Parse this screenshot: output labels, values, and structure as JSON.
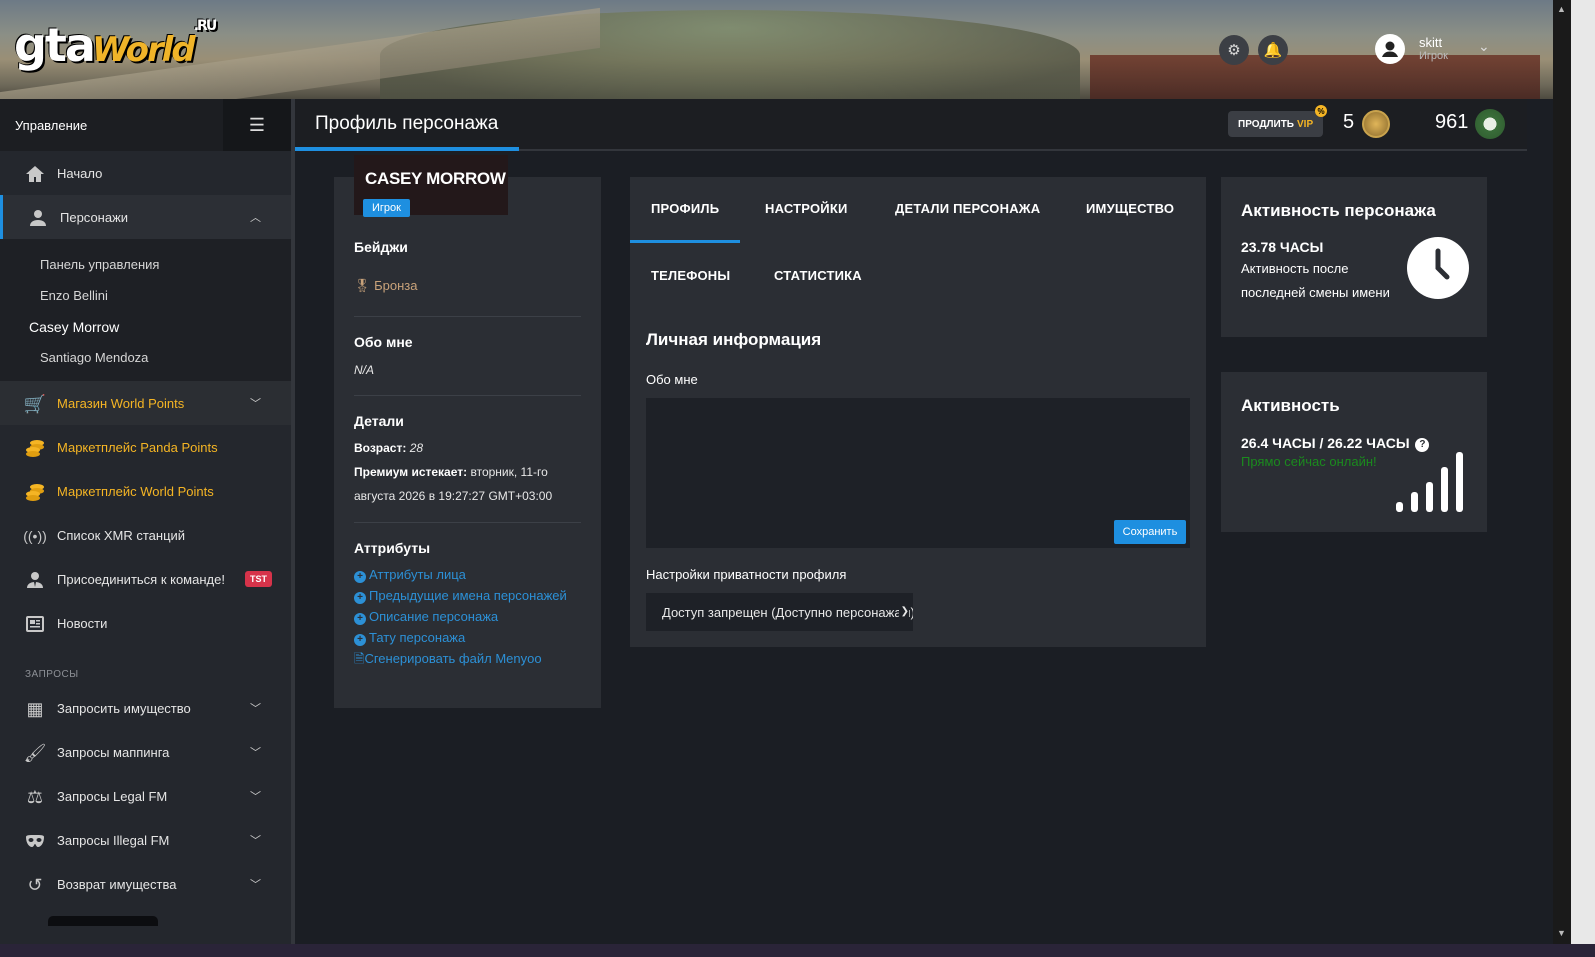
{
  "header": {
    "logo_text": "gta",
    "logo_world": "World",
    "logo_ru": ".RU",
    "user_name": "skitt",
    "user_role": "Игрок",
    "icons": [
      "gear-icon",
      "bell-icon",
      "user-avatar-icon",
      "chevron-down-icon"
    ]
  },
  "sidebar": {
    "title": "Управление",
    "items": [
      {
        "label": "Начало",
        "icon": "home-icon"
      },
      {
        "label": "Персонажи",
        "icon": "person-icon"
      }
    ],
    "characters": [
      "Панель управления",
      "Enzo Bellini",
      "Casey Morrow",
      "Santiago Mendoza"
    ],
    "shop_items": [
      {
        "label": "Магазин World Points",
        "icon": "cart-icon"
      },
      {
        "label": "Маркетплейс Panda Points",
        "icon": "coins-icon"
      },
      {
        "label": "Маркетплейс World Points",
        "icon": "coins-icon"
      }
    ],
    "misc_items": [
      {
        "label": "Список XMR станций",
        "icon": "antenna-icon"
      },
      {
        "label": "Присоединиться к команде!",
        "icon": "user-tie-icon",
        "badge": "TST"
      },
      {
        "label": "Новости",
        "icon": "newspaper-icon"
      }
    ],
    "requests_label": "ЗАПРОСЫ",
    "request_items": [
      {
        "label": "Запросить имущество",
        "icon": "building-icon"
      },
      {
        "label": "Запросы маппинга",
        "icon": "brush-icon"
      },
      {
        "label": "Запросы Legal FM",
        "icon": "scales-icon"
      },
      {
        "label": "Запросы Illegal FM",
        "icon": "mask-icon"
      },
      {
        "label": "Возврат имущества",
        "icon": "undo-icon"
      }
    ]
  },
  "page": {
    "title": "Профиль персонажа",
    "vip_label": "ПРОДЛИТЬ",
    "vip_word": "VIP",
    "vip_pct": "%",
    "vip_count": "5",
    "panda_count": "961"
  },
  "profile": {
    "name": "CASEY MORROW",
    "role": "Игрок",
    "badges_h": "Бейджи",
    "badge": "Бронза",
    "about_h": "Обо мне",
    "about": "N/A",
    "details_h": "Детали",
    "age_label": "Возраст:",
    "age": "28",
    "premium_label": "Премиум истекает:",
    "premium_value": "вторник, 11-го августа 2026 в 19:27:27 GMT+03:00",
    "attrs_h": "Аттрибуты",
    "attrs": [
      "Аттрибуты лица",
      "Предыдущие имена персонажей",
      "Описание персонажа",
      "Тату персонажа"
    ],
    "menyoo": "Сгенерировать файл Menyoo"
  },
  "tabs": {
    "items": [
      "ПРОФИЛЬ",
      "НАСТРОЙКИ",
      "ДЕТАЛИ ПЕРСОНАЖА",
      "ИМУЩЕСТВО",
      "ТЕЛЕФОНЫ",
      "СТАТИСТИКА"
    ],
    "personal_h": "Личная информация",
    "about_label": "Обо мне",
    "about_value": "",
    "save": "Сохранить",
    "privacy_label": "Настройки приватности профиля",
    "privacy_value": "Доступ запрещен (Доступно персонажам)"
  },
  "activity_char": {
    "title": "Активность персонажа",
    "hours": "23.78 ЧАСЫ",
    "desc": "Активность после последней смены имени"
  },
  "activity": {
    "title": "Активность",
    "hours": "26.4 ЧАСЫ / 26.22 ЧАСЫ",
    "help": "?",
    "online": "Прямо сейчас онлайн!"
  },
  "colors": {
    "accent": "#1e8fe0",
    "gold": "#f5b524",
    "online": "#1b8a1e",
    "badge_red": "#d6334a"
  }
}
